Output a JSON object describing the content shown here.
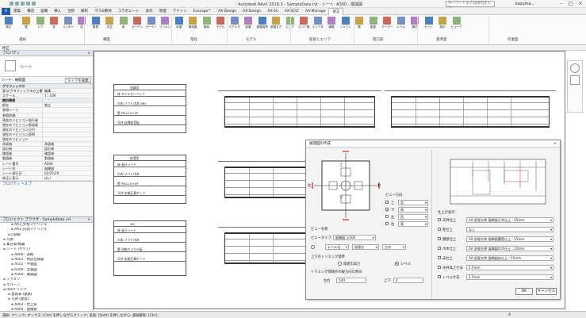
{
  "titlebar": {
    "title": "Autodesk Revit 2018.3 - SampleData.rvt - シート: A300 - 展開図",
    "search_placeholder": "キーワードまたは語句を入力",
    "user": "kazuma..."
  },
  "tabs": [
    "R",
    "建築",
    "構造",
    "設備",
    "挿入",
    "注釈",
    "解析",
    "マス&敷地",
    "コラボレート",
    "表示",
    "管理",
    "アドイン",
    "Enscape™",
    "AX-Design",
    "AX-Design",
    "AX-SC",
    "AX-SCLT",
    "AX-Manage",
    "修正"
  ],
  "ribbon": {
    "tools": [
      "修正",
      "壁",
      "ドア",
      "窓",
      "コンポーネント",
      "柱",
      "屋根",
      "天井",
      "床",
      "カーテンシステム",
      "カーテングリッド",
      "マリオン",
      "手摺",
      "傾斜路",
      "階段",
      "モデル",
      "モデルグループ",
      "部屋",
      "部屋境界",
      "部屋タグ",
      "エリア",
      "エリア境界",
      "エリアタグ",
      "通路",
      "シャフト",
      "壁",
      "垂直",
      "ドーマー",
      "レベル",
      "通芯",
      "セット",
      "表示",
      "ビューア"
    ],
    "panels": [
      "選択",
      "構築",
      "階段",
      "モデル",
      "部屋とエリア",
      "開口部",
      "基準面",
      "作業面"
    ]
  },
  "selbar": "修正",
  "properties": {
    "title": "プロパティ",
    "type_name": "シート",
    "selector": "シート: 展開図",
    "edit_type": "タイプを編集",
    "rows": [
      {
        "k": "グラフィックス",
        "v": "",
        "g": true
      },
      {
        "k": "表示/グラフィックスの上書き",
        "v": "編集..."
      },
      {
        "k": "スケール",
        "v": "1 : 100"
      },
      {
        "k": "識別情報",
        "v": "",
        "g": true
      },
      {
        "k": "依存",
        "v": "独立"
      },
      {
        "k": "参照シート",
        "v": ""
      },
      {
        "k": "参照詳細",
        "v": ""
      },
      {
        "k": "現在のリビジョン発行者",
        "v": ""
      },
      {
        "k": "現在のリビジョン承認者",
        "v": ""
      },
      {
        "k": "現在のリビジョン日付",
        "v": ""
      },
      {
        "k": "現在のリビジョン説明",
        "v": ""
      },
      {
        "k": "現在のリビジョン",
        "v": ""
      },
      {
        "k": "承認者",
        "v": "承認者"
      },
      {
        "k": "設計者",
        "v": "設計者"
      },
      {
        "k": "確認者",
        "v": "確認者"
      },
      {
        "k": "製図者",
        "v": "製図者"
      },
      {
        "k": "シート番号",
        "v": "A300"
      },
      {
        "k": "シート名",
        "v": "展開図"
      },
      {
        "k": "シート発行日",
        "v": "02/25/20"
      },
      {
        "k": "修正に表示",
        "v": "はい"
      }
    ],
    "help": "プロパティ ヘルプ"
  },
  "browser": {
    "title": "プロジェクト ブラウザ - SampleData.rvt",
    "items": [
      "AX3_外壁マテリアル",
      "AX3_内部マテリアル",
      "[詳細]",
      "凡例",
      "集計表/数量",
      "シート (すべて)",
      "A000 - 表紙",
      "A001 - 特記仕様書",
      "A101 - 平面図",
      "A200 - 立面図",
      "A300 - 展開図",
      "ファミリ",
      "グループ",
      "Revit リンク",
      "建具表 (建具)",
      "凡例 (建具)",
      "A002 - 仕上表",
      "A004 - 面積表"
    ]
  },
  "sheets": [
    {
      "room": "会議室",
      "rows": [
        "床 タイルカーペット",
        "巾木 ソフト巾木 H60",
        "壁 PB12.5+EP",
        "天井 岩綿吸音板"
      ]
    },
    {
      "room": "給湯室",
      "rows": [
        "床 長尺シート",
        "巾木 ソフト巾木",
        "壁 PB12.5+EP",
        "天井 化粧石膏ボード"
      ]
    },
    {
      "room": "WC",
      "rows": [
        "床 長尺シート",
        "巾木 ソフト巾木",
        "壁 化粧ケイカル板",
        "天井 化粧石膏ボード"
      ]
    }
  ],
  "dialog": {
    "title": "展開図の作成",
    "view_dir_label": "ビュー方向",
    "dirs": [
      "上",
      "下",
      "左",
      "右"
    ],
    "dir_values": [
      "北",
      "南",
      "西",
      "東"
    ],
    "view_name_label": "ビュー名称",
    "view_type_label": "ビュータイプ",
    "view_type_value": "展開図 1/100",
    "view_name_value": "部屋名+方向",
    "level_label": "レベル名",
    "room_label": "部屋名",
    "dir_label": "方向",
    "crop_label": "上下のトリミング基準",
    "opt_room": "部屋の高さ",
    "opt_level": "レベル",
    "offset_label": "トリミング領域外の縦方向の余白",
    "offset_left": "左右",
    "offset_left_val": "500",
    "offset_top": "上下",
    "offset_top_val": "0",
    "preview_label": "仕上げ表示",
    "finish_rows": [
      {
        "k": "天井仕上",
        "v": "AX 部屋名称 展開図天井仕上 : 15mm"
      },
      {
        "k": "壁仕上",
        "v": "なし"
      },
      {
        "k": "腰壁仕上",
        "v": "AX 部屋名称 展開図腰壁仕上 : 15mm"
      },
      {
        "k": "巾木仕上",
        "v": "AX 部屋名称 展開図巾木仕上 : 15mm"
      },
      {
        "k": "床仕上",
        "v": "AX 部屋名称 展開図床仕上 : 15mm"
      },
      {
        "k": "天井高さ寸法",
        "v": "2.5mm"
      },
      {
        "k": "レベル寸法",
        "v": "2.5mm"
      }
    ],
    "ok": "OK",
    "cancel": "キャンセル"
  },
  "status": "選択: クリック; ボックス: [Ctrl] を押しながらクリック; 追加: [Shift] を押しながら; 選択解除: [Ctrl]...",
  "status_right": ":0"
}
